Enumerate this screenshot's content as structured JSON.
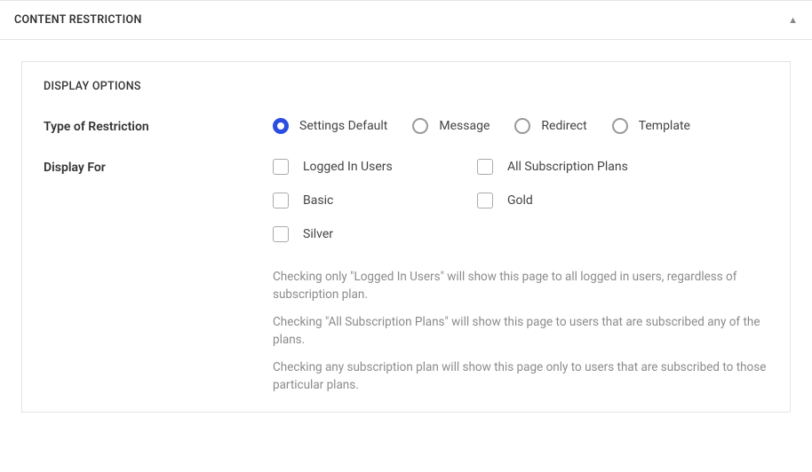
{
  "panel": {
    "title": "CONTENT RESTRICTION"
  },
  "section": {
    "title": "DISPLAY OPTIONS"
  },
  "fields": {
    "restriction": {
      "label": "Type of Restriction",
      "options": {
        "settings_default": "Settings Default",
        "message": "Message",
        "redirect": "Redirect",
        "template": "Template"
      },
      "selected": "settings_default"
    },
    "display_for": {
      "label": "Display For",
      "options": {
        "logged_in": "Logged In Users",
        "all_plans": "All Subscription Plans",
        "basic": "Basic",
        "gold": "Gold",
        "silver": "Silver"
      }
    }
  },
  "help": {
    "p1": "Checking only \"Logged In Users\" will show this page to all logged in users, regardless of subscription plan.",
    "p2": "Checking \"All Subscription Plans\" will show this page to users that are subscribed any of the plans.",
    "p3": "Checking any subscription plan will show this page only to users that are subscribed to those particular plans."
  }
}
